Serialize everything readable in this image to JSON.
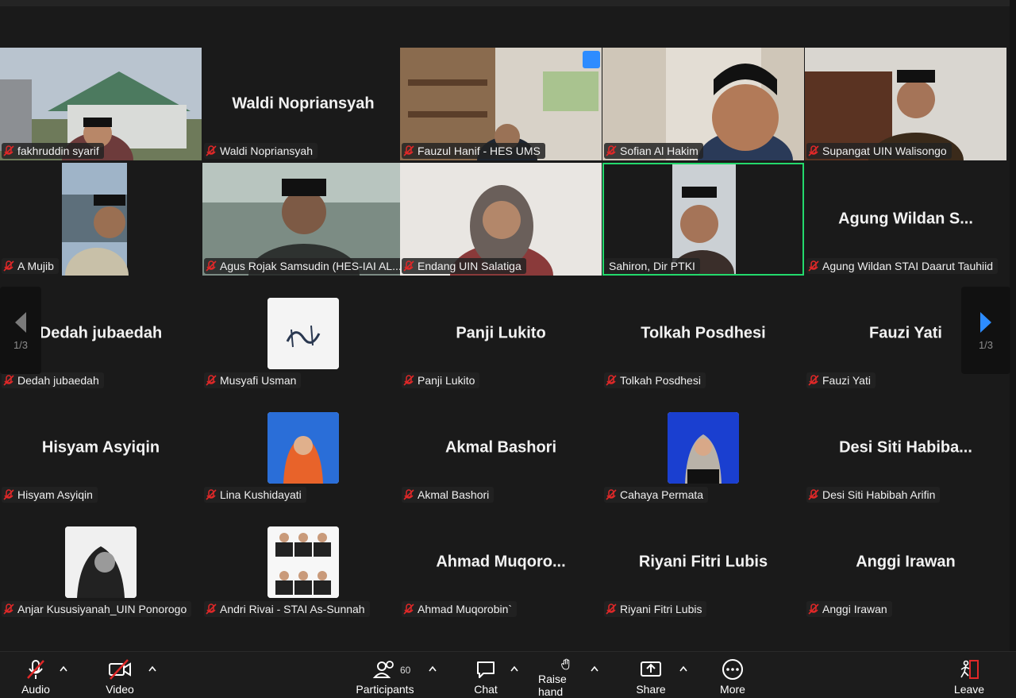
{
  "gallery": {
    "tiles": [
      {
        "name": "fakhruddin syarif",
        "display": ""
      },
      {
        "name": "Waldi Nopriansyah",
        "display": "Waldi  Nopriansyah"
      },
      {
        "name": "Fauzul Hanif - HES UMS",
        "display": ""
      },
      {
        "name": "Sofian Al Hakim",
        "display": ""
      },
      {
        "name": "Supangat UIN Walisongo",
        "display": ""
      },
      {
        "name": "A Mujib",
        "display": ""
      },
      {
        "name": "Agus Rojak Samsudin (HES-IAI AL...",
        "display": ""
      },
      {
        "name": "Endang UIN Salatiga",
        "display": ""
      },
      {
        "name": "Sahiron, Dir PTKI",
        "display": ""
      },
      {
        "name": "Agung Wildan STAI Daarut Tauhiid",
        "display": "Agung Wildan S..."
      },
      {
        "name": "Dedah jubaedah",
        "display": "Dedah jubaedah"
      },
      {
        "name": "Musyafi Usman",
        "display": ""
      },
      {
        "name": "Panji Lukito",
        "display": "Panji Lukito"
      },
      {
        "name": "Tolkah Posdhesi",
        "display": "Tolkah Posdhesi"
      },
      {
        "name": "Fauzi Yati",
        "display": "Fauzi Yati"
      },
      {
        "name": "Hisyam Asyiqin",
        "display": "Hisyam Asyiqin"
      },
      {
        "name": "Lina Kushidayati",
        "display": ""
      },
      {
        "name": "Akmal Bashori",
        "display": "Akmal Bashori"
      },
      {
        "name": "Cahaya Permata",
        "display": ""
      },
      {
        "name": "Desi Siti Habibah Arifin",
        "display": "Desi  Siti  Habiba..."
      },
      {
        "name": "Anjar Kususiyanah_UIN Ponorogo",
        "display": ""
      },
      {
        "name": "Andri Rivai - STAI As-Sunnah",
        "display": ""
      },
      {
        "name": "Ahmad Muqorobin`",
        "display": "Ahmad  Muqoro..."
      },
      {
        "name": "Riyani Fitri Lubis",
        "display": "Riyani Fitri Lubis"
      },
      {
        "name": "Anggi Irawan",
        "display": "Anggi Irawan"
      }
    ],
    "page_left": "1/3",
    "page_right": "1/3",
    "active_speaker_color": "#23d96c",
    "arrow_color": "#2d8cff"
  },
  "toolbar": {
    "audio": "Audio",
    "video": "Video",
    "participants": "Participants",
    "participants_count": "60",
    "chat": "Chat",
    "raise_hand": "Raise hand",
    "share": "Share",
    "more": "More",
    "leave": "Leave",
    "leave_color": "#e02828"
  }
}
